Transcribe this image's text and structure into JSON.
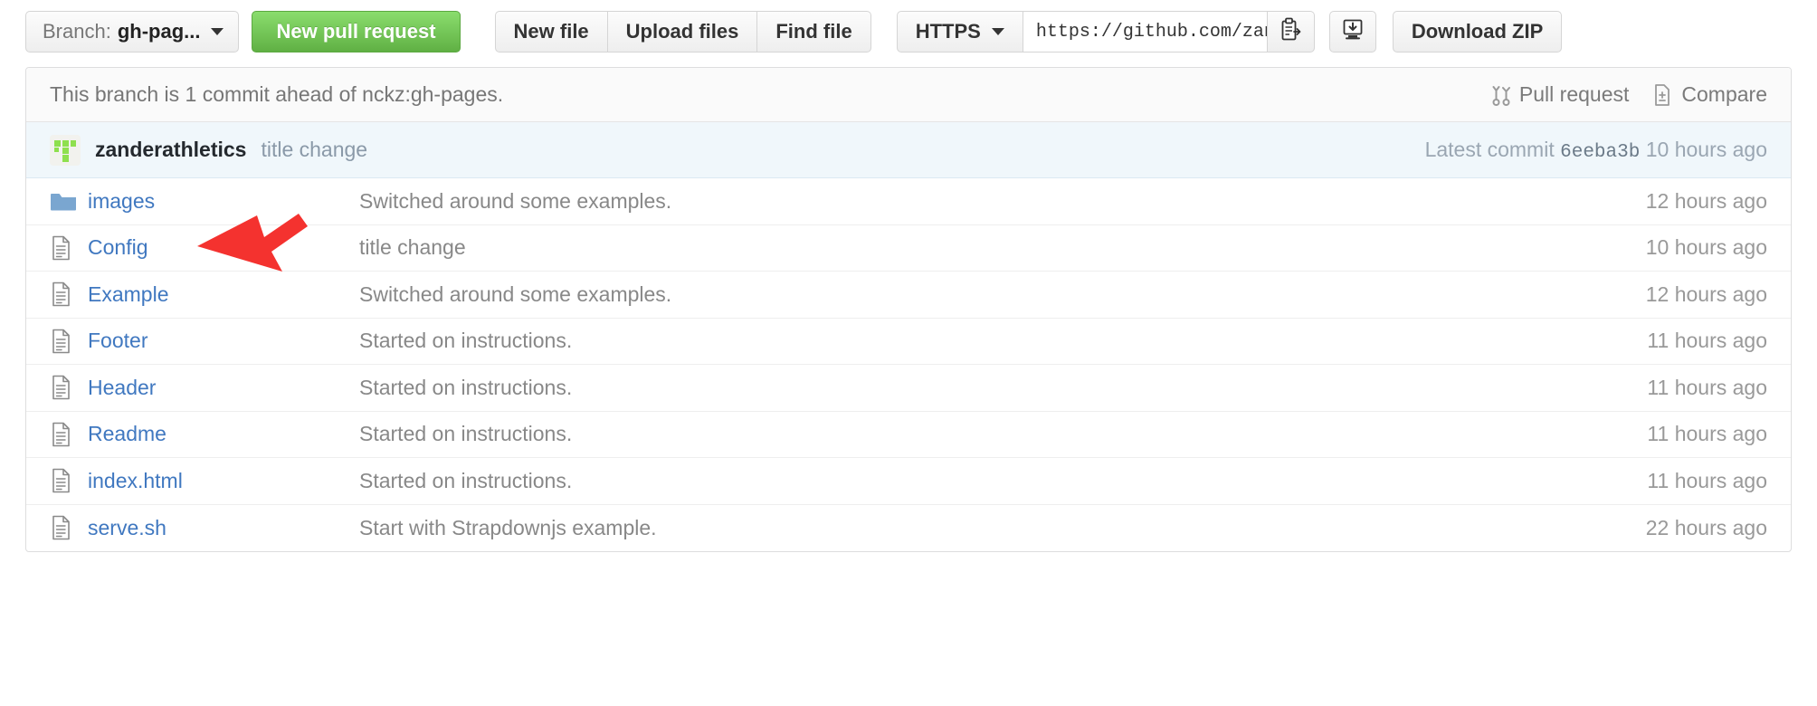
{
  "toolbar": {
    "branch_prefix": "Branch:",
    "branch_name": "gh-pag...",
    "new_pull_request": "New pull request",
    "new_file": "New file",
    "upload_files": "Upload files",
    "find_file": "Find file",
    "clone_protocol": "HTTPS",
    "clone_url": "https://github.com/zander",
    "copy_icon": "clipboard-copy-icon",
    "desktop_icon": "desktop-download-icon",
    "download_zip": "Download ZIP"
  },
  "branch_notice": {
    "text": "This branch is 1 commit ahead of nckz:gh-pages.",
    "pull_request": "Pull request",
    "compare": "Compare",
    "pull_request_icon": "git-pull-request-icon",
    "compare_icon": "file-diff-icon"
  },
  "latest_commit": {
    "avatar_icon": "user-avatar",
    "author": "zanderathletics",
    "message": "title change",
    "label": "Latest commit",
    "sha": "6eeba3b",
    "age": "10 hours ago"
  },
  "files": [
    {
      "type": "folder",
      "icon": "folder-icon",
      "name": "images",
      "message": "Switched around some examples.",
      "age": "12 hours ago"
    },
    {
      "type": "file",
      "icon": "file-text-icon",
      "name": "Config",
      "message": "title change",
      "age": "10 hours ago"
    },
    {
      "type": "file",
      "icon": "file-text-icon",
      "name": "Example",
      "message": "Switched around some examples.",
      "age": "12 hours ago"
    },
    {
      "type": "file",
      "icon": "file-text-icon",
      "name": "Footer",
      "message": "Started on instructions.",
      "age": "11 hours ago"
    },
    {
      "type": "file",
      "icon": "file-text-icon",
      "name": "Header",
      "message": "Started on instructions.",
      "age": "11 hours ago"
    },
    {
      "type": "file",
      "icon": "file-text-icon",
      "name": "Readme",
      "message": "Started on instructions.",
      "age": "11 hours ago"
    },
    {
      "type": "file",
      "icon": "file-text-icon",
      "name": "index.html",
      "message": "Started on instructions.",
      "age": "11 hours ago"
    },
    {
      "type": "file",
      "icon": "file-text-icon",
      "name": "serve.sh",
      "message": "Start with Strapdownjs example.",
      "age": "22 hours ago"
    }
  ],
  "annotation": {
    "icon": "red-arrow-pointer",
    "target": "Config",
    "color": "#f4322f"
  },
  "colors": {
    "link": "#4078c0",
    "green_button": "#60b044",
    "folder": "#7aa6d0",
    "annotation_red": "#f4322f",
    "commit_band": "#f0f7fb"
  }
}
